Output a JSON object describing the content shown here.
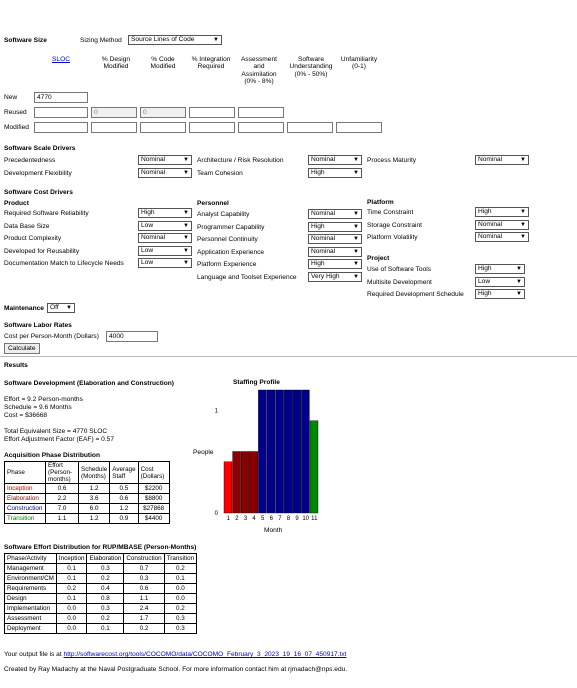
{
  "size": {
    "heading": "Software Size",
    "sizing_method_label": "Sizing Method",
    "sizing_method_value": "Source Lines of Code",
    "col_sloc": "SLOC",
    "col_design": "% Design Modified",
    "col_code": "% Code Modified",
    "col_integration": "% Integration Required",
    "col_aa": "Assessment and Assimilation (0% - 8%)",
    "col_su": "Software Understanding (0% - 50%)",
    "col_unfam": "Unfamiliarity (0-1)",
    "row_new": "New",
    "row_reused": "Reused",
    "row_modified": "Modified",
    "new_sloc": "4770",
    "reused_design": "0",
    "reused_code": "0"
  },
  "scale_drivers": {
    "heading": "Software Scale Drivers",
    "items": [
      {
        "label": "Precedentedness",
        "value": "Nominal"
      },
      {
        "label": "Development Flexibility",
        "value": "Nominal"
      },
      {
        "label": "Architecture / Risk Resolution",
        "value": "Nominal"
      },
      {
        "label": "Team Cohesion",
        "value": "High"
      },
      {
        "label": "Process Maturity",
        "value": "Nominal"
      }
    ]
  },
  "cost_drivers": {
    "heading": "Software Cost Drivers",
    "product_heading": "Product",
    "personnel_heading": "Personnel",
    "platform_heading": "Platform",
    "project_heading": "Project",
    "product": [
      {
        "label": "Required Software Reliability",
        "value": "High"
      },
      {
        "label": "Data Base Size",
        "value": "Low"
      },
      {
        "label": "Product Complexity",
        "value": "Nominal"
      },
      {
        "label": "Developed for Reusability",
        "value": "Low"
      },
      {
        "label": "Documentation Match to Lifecycle Needs",
        "value": "Low"
      }
    ],
    "personnel": [
      {
        "label": "Analyst Capability",
        "value": "Nominal"
      },
      {
        "label": "Programmer Capability",
        "value": "High"
      },
      {
        "label": "Personnel Continuity",
        "value": "Nominal"
      },
      {
        "label": "Application Experience",
        "value": "Nominal"
      },
      {
        "label": "Platform Experience",
        "value": "High"
      },
      {
        "label": "Language and Toolset Experience",
        "value": "Very High"
      }
    ],
    "platform": [
      {
        "label": "Time Constraint",
        "value": "High"
      },
      {
        "label": "Storage Constraint",
        "value": "Nominal"
      },
      {
        "label": "Platform Volatility",
        "value": "Nominal"
      }
    ],
    "project": [
      {
        "label": "Use of Software Tools",
        "value": "High"
      },
      {
        "label": "Multisite Development",
        "value": "Low"
      },
      {
        "label": "Required Development Schedule",
        "value": "High"
      }
    ]
  },
  "maintenance": {
    "label": "Maintenance",
    "value": "Off"
  },
  "labor": {
    "heading": "Software Labor Rates",
    "cost_label": "Cost per Person-Month (Dollars)",
    "cost_value": "4000",
    "calculate": "Calculate"
  },
  "results": {
    "heading": "Results",
    "dev_heading": "Software Development (Elaboration and Construction)",
    "effort": "Effort = 9.2 Person-months",
    "schedule": "Schedule = 9.6 Months",
    "cost": "Cost = $36668",
    "equiv_size": "Total Equivalent Size = 4770 SLOC",
    "eaf": "Effort Adjustment Factor (EAF) = 0.57",
    "phase_heading": "Acquisition Phase Distribution",
    "phase_headers": [
      "Phase",
      "Effort (Person-months)",
      "Schedule (Months)",
      "Average Staff",
      "Cost (Dollars)"
    ],
    "phases": [
      {
        "name": "Inception",
        "effort": "0.6",
        "schedule": "1.2",
        "staff": "0.5",
        "cost": "$2200",
        "color": "#cc0000"
      },
      {
        "name": "Elaboration",
        "effort": "2.2",
        "schedule": "3.6",
        "staff": "0.6",
        "cost": "$8800",
        "color": "#8b0000"
      },
      {
        "name": "Construction",
        "effort": "7.0",
        "schedule": "6.0",
        "staff": "1.2",
        "cost": "$27868",
        "color": "#0000aa"
      },
      {
        "name": "Transition",
        "effort": "1.1",
        "schedule": "1.2",
        "staff": "0.9",
        "cost": "$4400",
        "color": "#008800"
      }
    ],
    "rup_heading": "Software Effort Distribution for RUP/MBASE (Person-Months)",
    "rup_headers": [
      "Phase/Activity",
      "Inception",
      "Elaboration",
      "Construction",
      "Transition"
    ],
    "rup_rows": [
      [
        "Management",
        "0.1",
        "0.3",
        "0.7",
        "0.2"
      ],
      [
        "Environment/CM",
        "0.1",
        "0.2",
        "0.3",
        "0.1"
      ],
      [
        "Requirements",
        "0.2",
        "0.4",
        "0.6",
        "0.0"
      ],
      [
        "Design",
        "0.1",
        "0.8",
        "1.1",
        "0.0"
      ],
      [
        "Implementation",
        "0.0",
        "0.3",
        "2.4",
        "0.2"
      ],
      [
        "Assessment",
        "0.0",
        "0.2",
        "1.7",
        "0.3"
      ],
      [
        "Deployment",
        "0.0",
        "0.1",
        "0.2",
        "0.3"
      ]
    ]
  },
  "chart_data": {
    "type": "bar",
    "title": "Staffing Profile",
    "ylabel": "People",
    "xlabel": "Month",
    "categories": [
      "1",
      "2",
      "3",
      "4",
      "5",
      "6",
      "7",
      "8",
      "9",
      "10",
      "11"
    ],
    "values": [
      0.5,
      0.6,
      0.6,
      0.6,
      1.2,
      1.2,
      1.2,
      1.2,
      1.2,
      1.2,
      0.9
    ],
    "colors": [
      "#ff0000",
      "#8b0000",
      "#8b0000",
      "#8b0000",
      "#00008b",
      "#00008b",
      "#00008b",
      "#00008b",
      "#00008b",
      "#00008b",
      "#008800"
    ],
    "y_ticks": [
      "1",
      "0"
    ],
    "ylim": [
      0,
      1.2
    ]
  },
  "footer": {
    "output_prefix": "Your output file is at",
    "output_link": "http://softwarecost.org/tools/COCOMO/data/COCOMO_February_3_2023_19_16_07_450917.txt",
    "credit": "Created by Ray Madachy at the Naval Postgraduate School. For more information contact him at rjmadach@nps.edu."
  }
}
